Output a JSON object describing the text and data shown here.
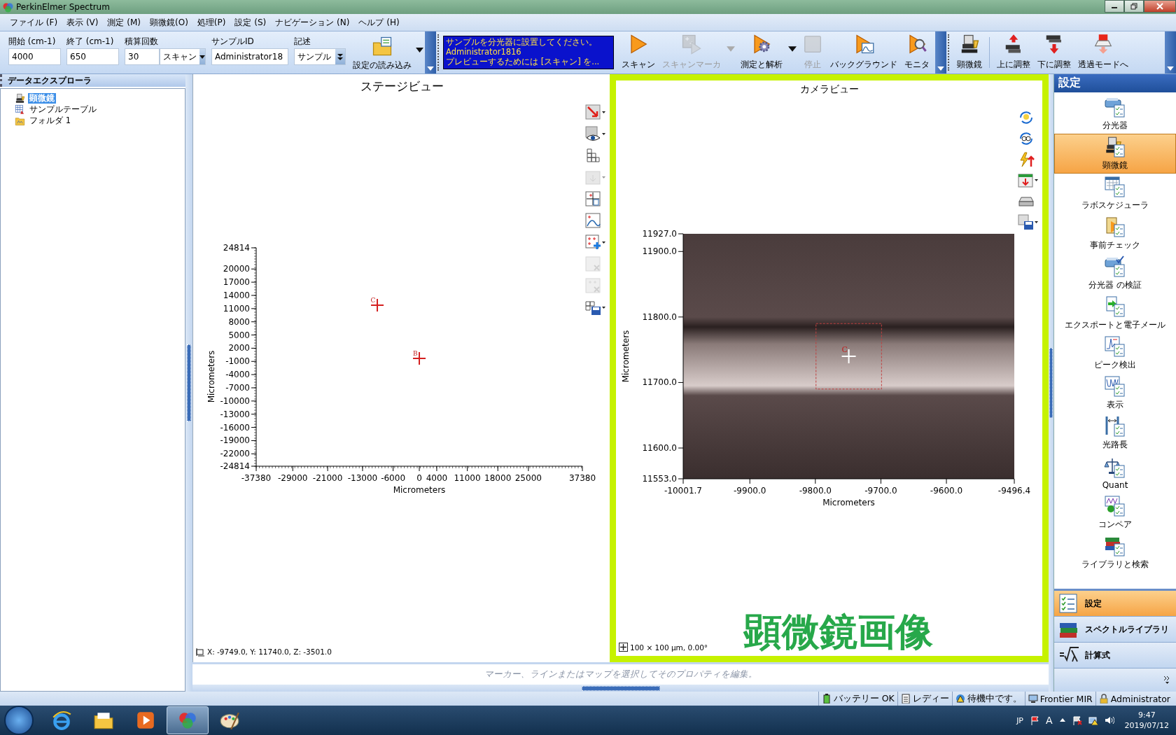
{
  "window": {
    "title": "PerkinElmer Spectrum"
  },
  "menu": [
    "ファイル (F)",
    "表示 (V)",
    "測定 (M)",
    "顕微鏡(O)",
    "処理(P)",
    "設定 (S)",
    "ナビゲーション (N)",
    "ヘルプ (H)"
  ],
  "scan_settings": {
    "fields": [
      {
        "kind": "text",
        "label": "開始 (cm-1)",
        "value": "4000"
      },
      {
        "kind": "text",
        "label": "終了 (cm-1)",
        "value": "650"
      },
      {
        "kind": "count",
        "label": "積算回数",
        "value": "30",
        "unit": "スキャン"
      },
      {
        "kind": "text",
        "label": "サンプルID",
        "value": "Administrator18"
      },
      {
        "kind": "select",
        "label": "記述",
        "value": "サンプル"
      }
    ],
    "load_button": "設定の読み込み"
  },
  "message": [
    "サンプルを分光器に設置してください。",
    "Administrator1816",
    "プレビューするためには [スキャン] を..."
  ],
  "scan_buttons": [
    {
      "label": "スキャン",
      "disabled": false,
      "menu": false
    },
    {
      "label": "スキャンマーカ",
      "disabled": true,
      "menu": true
    },
    {
      "label": "測定と解析",
      "disabled": false,
      "menu": true
    },
    {
      "label": "停止",
      "disabled": true,
      "menu": false
    },
    {
      "label": "バックグラウンド",
      "disabled": false,
      "menu": false
    },
    {
      "label": "モニタ",
      "disabled": false,
      "menu": false
    }
  ],
  "microscope_buttons": [
    "顕微鏡",
    "上に調整",
    "下に調整",
    "透過モードへ"
  ],
  "data_explorer": {
    "title": "データエクスプローラ",
    "tree": [
      {
        "label": "顕微鏡",
        "selected": true
      },
      {
        "label": "サンプルテーブル",
        "selected": false
      },
      {
        "label": "フォルダ 1",
        "selected": false
      }
    ]
  },
  "stage_view": {
    "title": "ステージビュー",
    "tools": [
      {
        "disabled": false
      },
      {
        "disabled": false
      },
      {
        "disabled": false
      },
      {
        "disabled": true
      },
      {
        "disabled": false
      },
      {
        "disabled": false
      },
      {
        "disabled": false
      },
      {
        "disabled": true
      },
      {
        "disabled": true
      },
      {
        "disabled": false
      }
    ],
    "chart_data": {
      "type": "scatter",
      "xlabel": "Micrometers",
      "ylabel": "Micrometers",
      "x": [
        -9700,
        0
      ],
      "series": [
        {
          "color": "#d42020",
          "values": [
            11700,
            -300
          ]
        }
      ],
      "xlim": [
        -37380,
        37380
      ],
      "ylim": [
        -24814,
        24814
      ],
      "xticks": [
        -37380,
        -29000,
        -21000,
        -13000,
        -6000,
        0,
        4000,
        11000,
        18000,
        25000,
        37380
      ],
      "yticks": [
        24814,
        20000,
        17000,
        14000,
        11000,
        8000,
        5000,
        2000,
        -1000,
        -4000,
        -7000,
        -10000,
        -13000,
        -16000,
        -19000,
        -22000,
        -24814
      ],
      "annotations": [
        {
          "text": "C"
        },
        {
          "text": "B"
        }
      ]
    },
    "coordinates": "X: -9749.0, Y: 11740.0, Z: -3501.0"
  },
  "camera_view": {
    "title": "カメラビュー",
    "chart_data": {
      "type": "scatter",
      "xlabel": "Micrometers",
      "ylabel": "Micrometers",
      "x": [
        -9749
      ],
      "series": [
        {
          "color": "#ffffff",
          "values": [
            11740
          ]
        }
      ],
      "xlim": [
        -10001.7,
        -9496.4
      ],
      "ylim": [
        11553,
        11927
      ],
      "xticks": [
        {
          "value": -10001.7,
          "label": "-10001.7"
        },
        {
          "value": -9900,
          "label": "-9900.0"
        },
        {
          "value": -9800,
          "label": "-9800.0"
        },
        {
          "value": -9700,
          "label": "-9700.0"
        },
        {
          "value": -9600,
          "label": "-9600.0"
        },
        {
          "value": -9496.4,
          "label": "-9496.4"
        }
      ],
      "yticks": [
        {
          "value": 11927,
          "label": "11927.0"
        },
        {
          "value": 11900,
          "label": "11900.0"
        },
        {
          "value": 11800,
          "label": "11800.0"
        },
        {
          "value": 11700,
          "label": "11700.0"
        },
        {
          "value": 11600,
          "label": "11600.0"
        },
        {
          "value": 11553,
          "label": "11553.0"
        }
      ],
      "annotations": [
        {
          "text": "C"
        }
      ]
    },
    "scale": "100 × 100 µm, 0.00°",
    "caption": "顕微鏡画像"
  },
  "property_hint": "マーカー、ラインまたはマップを選択してそのプロパティを編集。",
  "settings_panel": {
    "title": "設定",
    "items": [
      {
        "label": "分光器",
        "selected": false
      },
      {
        "label": "顕微鏡",
        "selected": true
      },
      {
        "label": "ラボスケジューラ",
        "selected": false
      },
      {
        "label": "事前チェック",
        "selected": false
      },
      {
        "label": "分光器 の検証",
        "selected": false
      },
      {
        "label": "エクスポートと電子メール",
        "selected": false
      },
      {
        "label": "ピーク検出",
        "selected": false
      },
      {
        "label": "表示",
        "selected": false
      },
      {
        "label": "光路長",
        "selected": false
      },
      {
        "label": "Quant",
        "selected": false
      },
      {
        "label": "コンペア",
        "selected": false
      },
      {
        "label": "ライブラリと検索",
        "selected": false
      }
    ],
    "nav": [
      {
        "label": "設定",
        "selected": true
      },
      {
        "label": "スペクトルライブラリ",
        "selected": false
      },
      {
        "label": "計算式",
        "selected": false
      }
    ]
  },
  "status_bar": [
    "バッテリー OK",
    "レディー",
    "待機中です。",
    "Frontier MIR",
    "Administrator"
  ],
  "taskbar": {
    "language": "JP",
    "ime": "A",
    "time": "9:47",
    "date": "2019/07/12"
  }
}
